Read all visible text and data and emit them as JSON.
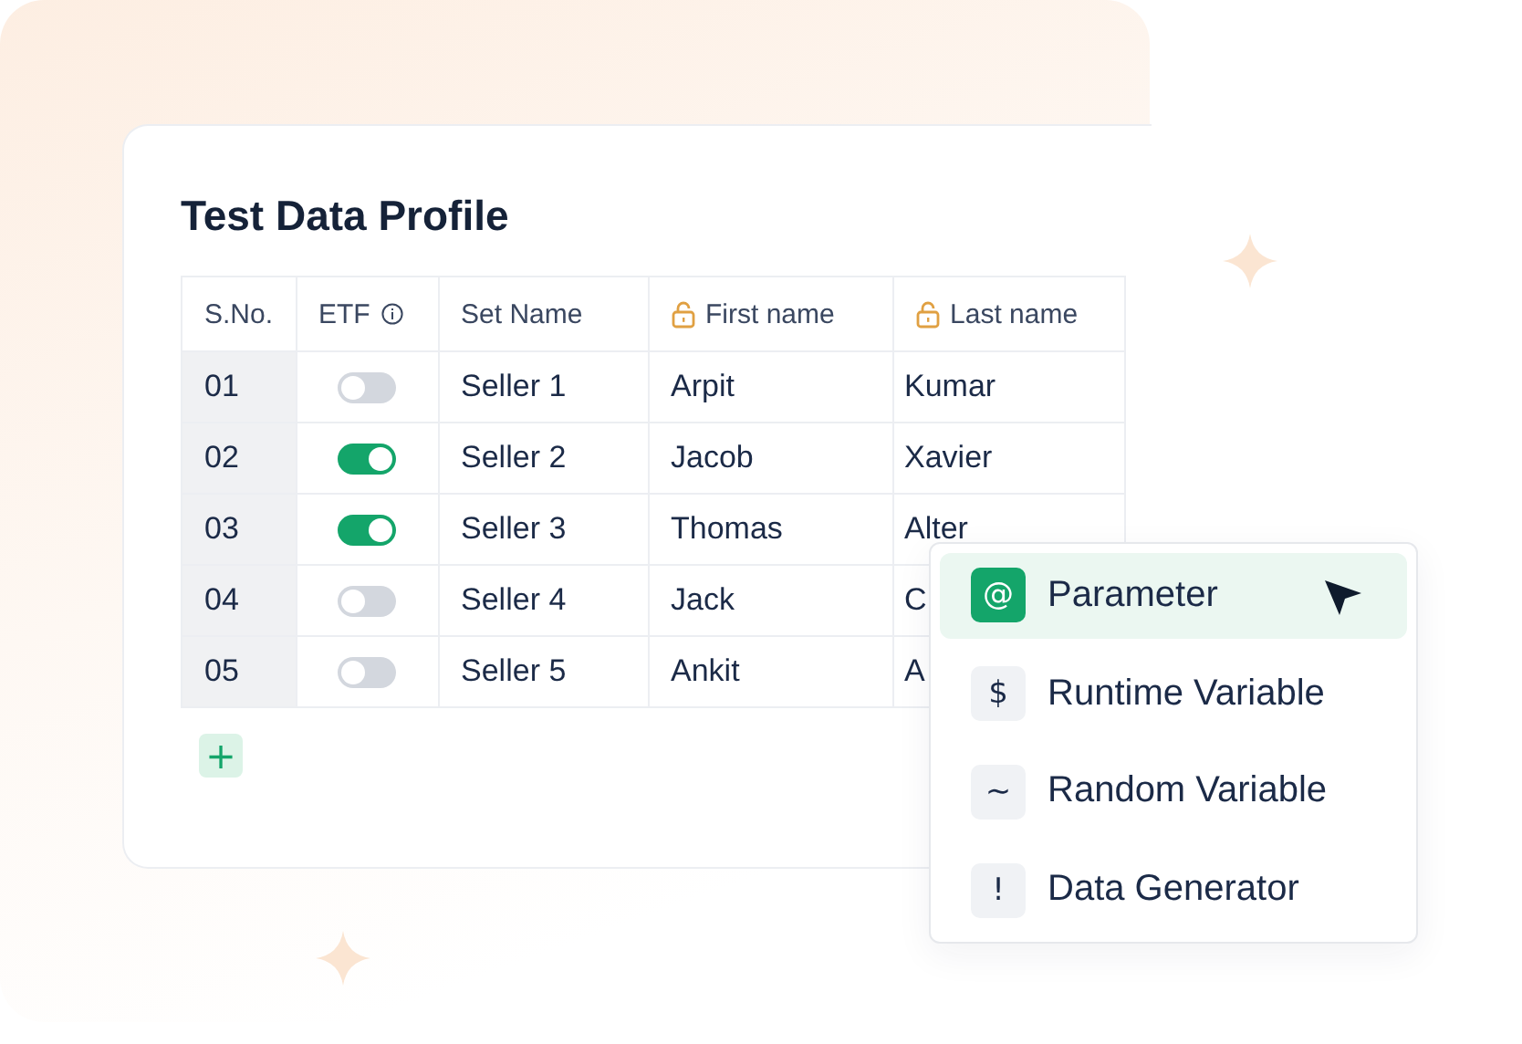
{
  "title": "Test Data Profile",
  "table": {
    "columns": [
      {
        "label": "S.No.",
        "kind": "plain"
      },
      {
        "label": "ETF",
        "kind": "info"
      },
      {
        "label": "Set Name",
        "kind": "plain"
      },
      {
        "label": "First name",
        "kind": "locked"
      },
      {
        "label": "Last name",
        "kind": "locked"
      }
    ],
    "rows": [
      {
        "number": "01",
        "etf": false,
        "set_name": "Seller 1",
        "first_name": "Arpit",
        "last_name": "Kumar"
      },
      {
        "number": "02",
        "etf": true,
        "set_name": "Seller 2",
        "first_name": "Jacob",
        "last_name": "Xavier"
      },
      {
        "number": "03",
        "etf": true,
        "set_name": "Seller 3",
        "first_name": "Thomas",
        "last_name": "Alter"
      },
      {
        "number": "04",
        "etf": false,
        "set_name": "Seller 4",
        "first_name": "Jack",
        "last_name": "C"
      },
      {
        "number": "05",
        "etf": false,
        "set_name": "Seller 5",
        "first_name": "Ankit",
        "last_name": "A"
      }
    ],
    "add_button": "+"
  },
  "menu": {
    "items": [
      {
        "symbol": "@",
        "label": "Parameter",
        "selected": true
      },
      {
        "symbol": "$",
        "label": "Runtime Variable",
        "selected": false
      },
      {
        "symbol": "~",
        "label": "Random Variable",
        "selected": false
      },
      {
        "symbol": "!",
        "label": "Data Generator",
        "selected": false
      }
    ]
  }
}
